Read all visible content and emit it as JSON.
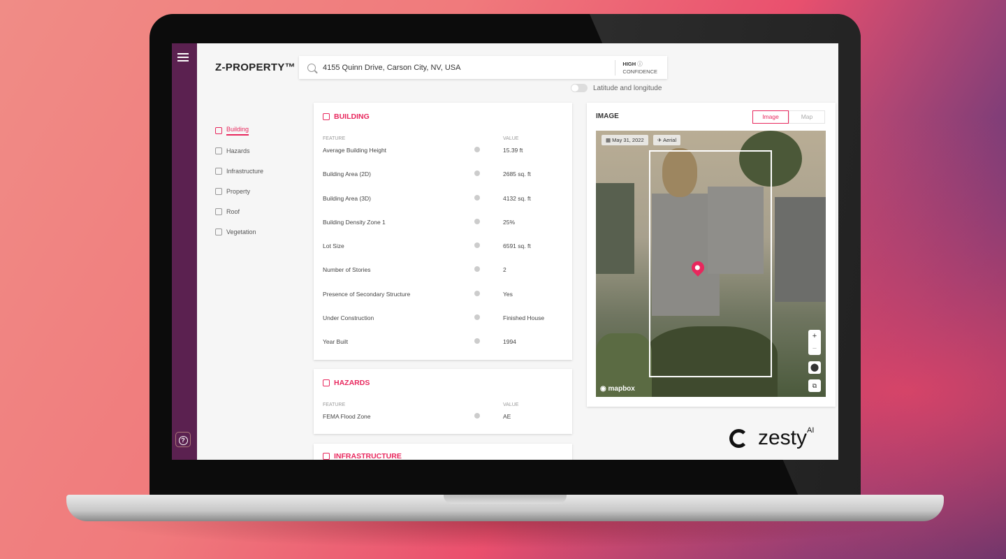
{
  "app": {
    "logo": "Z-PROPERTY™",
    "help_icon": "?"
  },
  "search": {
    "value": "4155 Quinn Drive, Carson City, NV, USA",
    "confidence_level": "HIGH",
    "confidence_label": "CONFIDENCE"
  },
  "toggle": {
    "label": "Latitude and longitude",
    "on": false
  },
  "nav": {
    "items": [
      {
        "label": "Building",
        "icon": "home-icon",
        "active": true
      },
      {
        "label": "Hazards",
        "icon": "warning-icon"
      },
      {
        "label": "Infrastructure",
        "icon": "infrastructure-icon"
      },
      {
        "label": "Property",
        "icon": "property-icon"
      },
      {
        "label": "Roof",
        "icon": "roof-icon"
      },
      {
        "label": "Vegetation",
        "icon": "leaf-icon"
      }
    ]
  },
  "building": {
    "title": "BUILDING",
    "col_feature": "FEATURE",
    "col_value": "VALUE",
    "rows": [
      {
        "feature": "Average Building Height",
        "value": "15.39 ft"
      },
      {
        "feature": "Building Area (2D)",
        "value": "2685 sq. ft"
      },
      {
        "feature": "Building Area (3D)",
        "value": "4132 sq. ft"
      },
      {
        "feature": "Building Density Zone 1",
        "value": "25%"
      },
      {
        "feature": "Lot Size",
        "value": "6591 sq. ft"
      },
      {
        "feature": "Number of Stories",
        "value": "2"
      },
      {
        "feature": "Presence of Secondary Structure",
        "value": "Yes"
      },
      {
        "feature": "Under Construction",
        "value": "Finished House"
      },
      {
        "feature": "Year Built",
        "value": "1994"
      }
    ]
  },
  "hazards": {
    "title": "HAZARDS",
    "col_feature": "FEATURE",
    "col_value": "VALUE",
    "rows": [
      {
        "feature": "FEMA Flood Zone",
        "value": "AE"
      }
    ]
  },
  "infrastructure": {
    "title": "INFRASTRUCTURE"
  },
  "image": {
    "title": "IMAGE",
    "tabs": [
      "Image",
      "Map"
    ],
    "active_tab": "Image",
    "date": "May 31, 2022",
    "source": "Aerial",
    "zoom_in": "+",
    "zoom_out": "−",
    "attribution": "mapbox"
  },
  "brand": {
    "name": "zesty",
    "suffix": "AI"
  },
  "colors": {
    "accent": "#e8275d",
    "rail": "#5b2150"
  }
}
